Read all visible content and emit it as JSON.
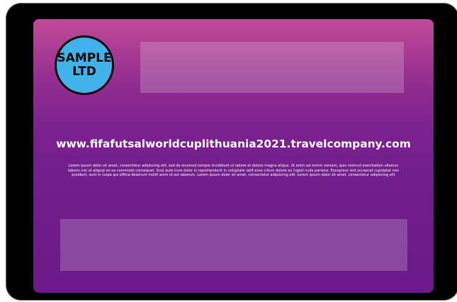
{
  "logo": {
    "text": "SAMPLE\nLTD"
  },
  "website": {
    "url": "www.fifafutsalworldcuplithuania2021.travelcompany.com"
  },
  "body_text": "Lorem ipsum dolor sit amet, consectetur adipiscing elit, sed do eiusmod tempor incididunt ut labore et dolore magna aliqua. Ut enim ad minim veniam, quis nostrud exercitation ullamco laboris nisi ut aliquip ex ea commodo consequat. Duis aute irure dolor in reprehenderit in voluptate velit esse cillum dolore eu fugiat nulla pariatur. Excepteur sint occaecat cupidatat non proident, sunt in culpa qui officia deserunt mollit anim id est laborum. Lorem ipsum dolor sit amet, consectetur adipiscing elit- Lorem ipsum dolor sit amet, consectetur adipiscing elit",
  "colors": {
    "device_frame": "#000000",
    "gradient_top": "#c04a97",
    "gradient_bottom": "#6c1a89",
    "logo_fill": "#41b2ea",
    "logo_border": "#0a0a0a",
    "text": "#ffffff"
  }
}
